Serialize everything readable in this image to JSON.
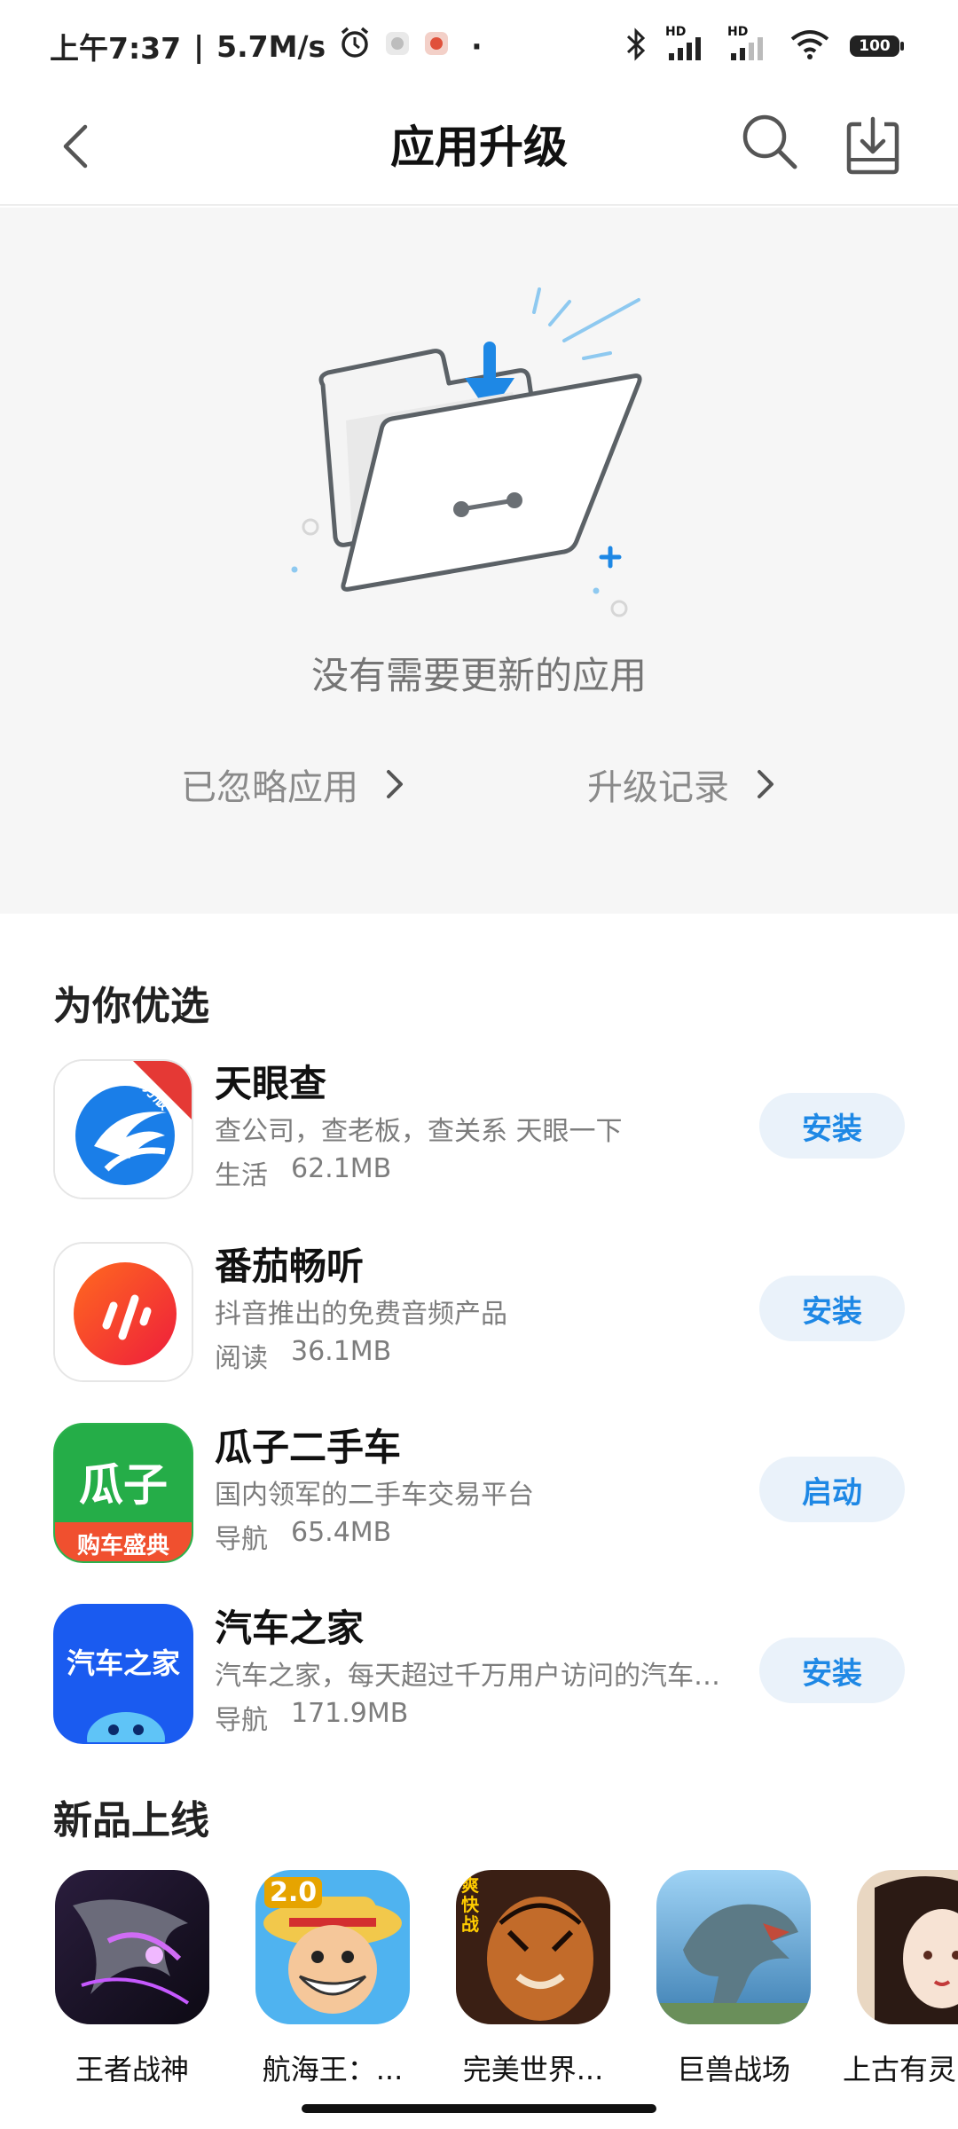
{
  "status_bar": {
    "time": "上午7:37",
    "separator": "|",
    "speed": "5.7M/s",
    "dot": "·",
    "signal_hd_1": "HD",
    "signal_hd_2": "HD",
    "battery": "100"
  },
  "header": {
    "title": "应用升级"
  },
  "empty_state": {
    "message": "没有需要更新的应用",
    "ignored_link": "已忽略应用",
    "history_link": "升级记录"
  },
  "recommend": {
    "section_title": "为你优选",
    "apps": [
      {
        "name": "天眼查",
        "desc": "查公司，查老板，查关系 天眼一下",
        "category": "生活",
        "size": "62.1MB",
        "action": "安装",
        "badge": "官方版"
      },
      {
        "name": "番茄畅听",
        "desc": "抖音推出的免费音频产品",
        "category": "阅读",
        "size": "36.1MB",
        "action": "安装"
      },
      {
        "name": "瓜子二手车",
        "desc": "国内领军的二手车交易平台",
        "category": "导航",
        "size": "65.4MB",
        "action": "启动",
        "icon_text": "瓜子",
        "icon_sub": "购车盛典"
      },
      {
        "name": "汽车之家",
        "desc": "汽车之家，每天超过千万用户访问的汽车网站",
        "category": "导航",
        "size": "171.9MB",
        "action": "安装",
        "icon_text": "汽车之家"
      }
    ]
  },
  "new_arrivals": {
    "section_title": "新品上线",
    "items": [
      {
        "label": "王者战神"
      },
      {
        "label": "航海王：...",
        "badge": "2.0"
      },
      {
        "label": "完美世界...",
        "badge": "爽快战"
      },
      {
        "label": "巨兽战场"
      },
      {
        "label": "上古有灵"
      }
    ]
  },
  "colors": {
    "accent": "#1e88e5",
    "button_bg": "#eaf2fa",
    "panel_bg": "#f6f6f6"
  }
}
